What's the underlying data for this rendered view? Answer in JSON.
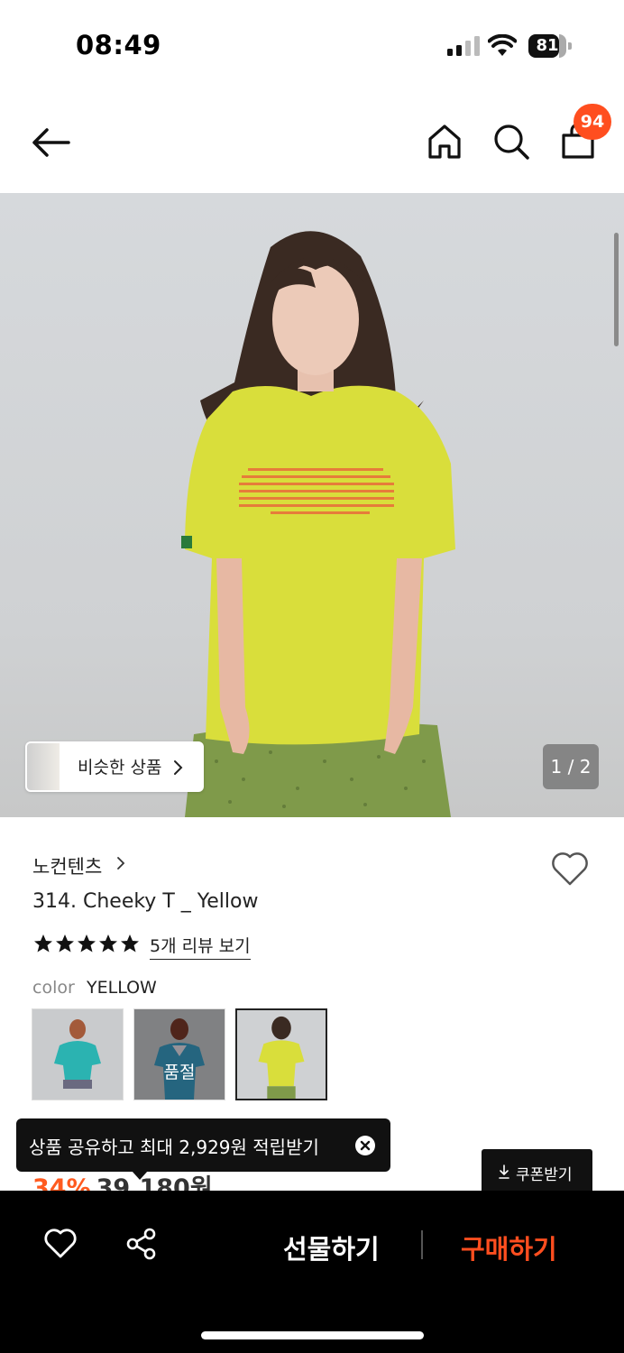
{
  "status_bar": {
    "time": "08:49",
    "battery": "81"
  },
  "nav": {
    "cart_count": "94"
  },
  "hero": {
    "similar_label": "비슷한 상품",
    "page_indicator": "1 / 2"
  },
  "product": {
    "brand": "노컨텐츠",
    "title": "314. Cheeky T _ Yellow",
    "rating_stars": 5,
    "review_link": "5개 리뷰 보기",
    "color_label": "color",
    "color_value": "YELLOW",
    "swatches": [
      {
        "color": "#2bb3b1",
        "soldout": ""
      },
      {
        "color": "#3a9cc4",
        "soldout": "품절"
      },
      {
        "color": "#d9de3b",
        "soldout": ""
      }
    ],
    "price_pct": "34%",
    "price_value": "39,180원"
  },
  "tooltip": {
    "text": "상품 공유하고 최대 2,929원 적립받기"
  },
  "coupon": {
    "label": "쿠폰받기"
  },
  "bottom_bar": {
    "gift_label": "선물하기",
    "buy_label": "구매하기"
  },
  "colors": {
    "accent": "#ff4e1f",
    "bar_bg": "#000000"
  }
}
